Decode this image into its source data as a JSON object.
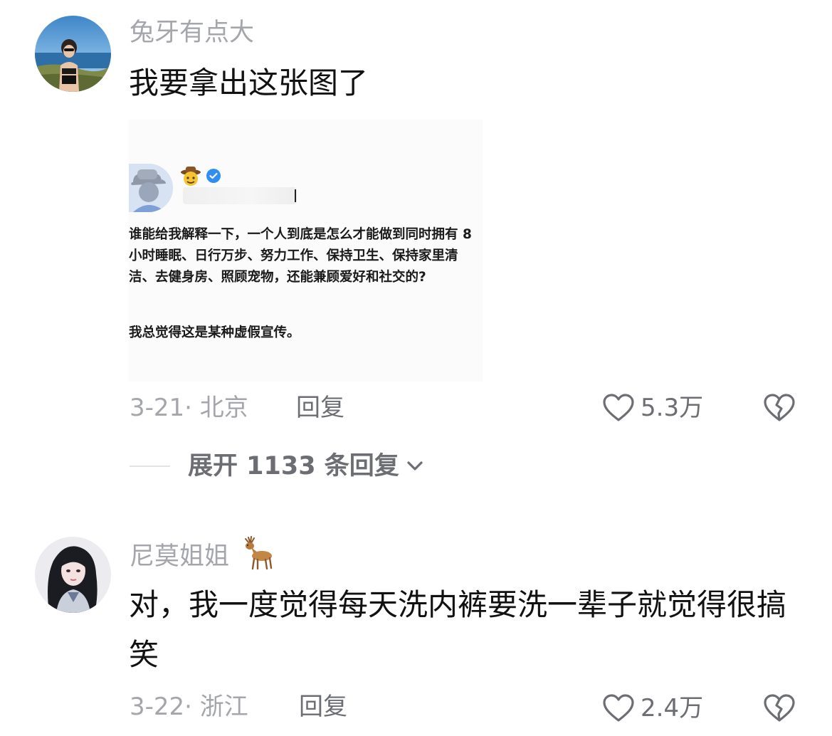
{
  "comments": [
    {
      "username": "兔牙有点大",
      "text": "我要拿出这张图了",
      "embedded_image": {
        "paragraph1": "谁能给我解释一下，一个人到底是怎么才能做到同时拥有 8 小时睡眠、日行万步、努力工作、保持卫生、保持家里清洁、去健身房、照顾宠物，还能兼顾爱好和社交的?",
        "paragraph2": "我总觉得这是某种虚假宣传。"
      },
      "meta": "3-21· 北京",
      "reply_label": "回复",
      "likes": "5.3万",
      "expand_label": "展开 1133 条回复"
    },
    {
      "username": "尼莫姐姐",
      "username_emoji": "deer-emoji",
      "text": "对，我一度觉得每天洗内裤要洗一辈子就觉得很搞笑",
      "meta": "3-22· 浙江",
      "reply_label": "回复",
      "likes": "2.4万"
    }
  ],
  "colors": {
    "username": "#a4a6ab",
    "body_text": "#111111",
    "action_text": "#6c6e73",
    "verified_badge": "#2f8ff0"
  }
}
